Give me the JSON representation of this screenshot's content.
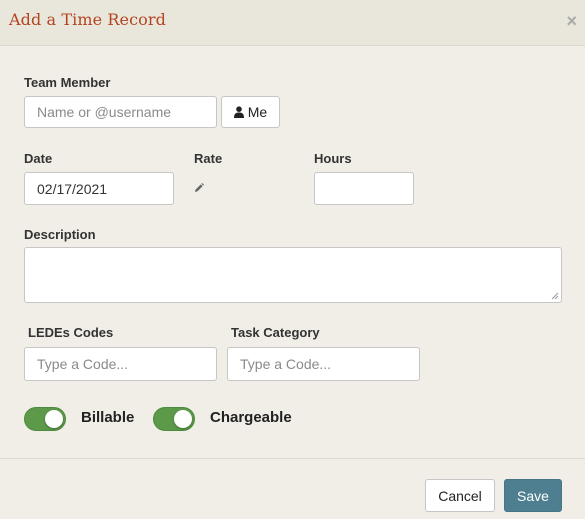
{
  "modal": {
    "title": "Add a Time Record",
    "close_glyph": "×"
  },
  "team_member": {
    "label": "Team Member",
    "placeholder": "Name or @username",
    "me_button": "Me",
    "me_icon": "user-icon"
  },
  "date": {
    "label": "Date",
    "value": "02/17/2021"
  },
  "rate": {
    "label": "Rate",
    "edit_icon": "pencil-icon"
  },
  "hours": {
    "label": "Hours",
    "value": ""
  },
  "description": {
    "label": "Description",
    "value": ""
  },
  "ledes": {
    "label": "LEDEs Codes",
    "placeholder": "Type a Code..."
  },
  "task_category": {
    "label": "Task Category",
    "placeholder": "Type a Code..."
  },
  "toggles": {
    "billable": {
      "label": "Billable",
      "on": true
    },
    "chargeable": {
      "label": "Chargeable",
      "on": true
    },
    "on_color": "#5c9a4a"
  },
  "footer": {
    "cancel": "Cancel",
    "save": "Save",
    "save_color": "#4e7f91"
  }
}
